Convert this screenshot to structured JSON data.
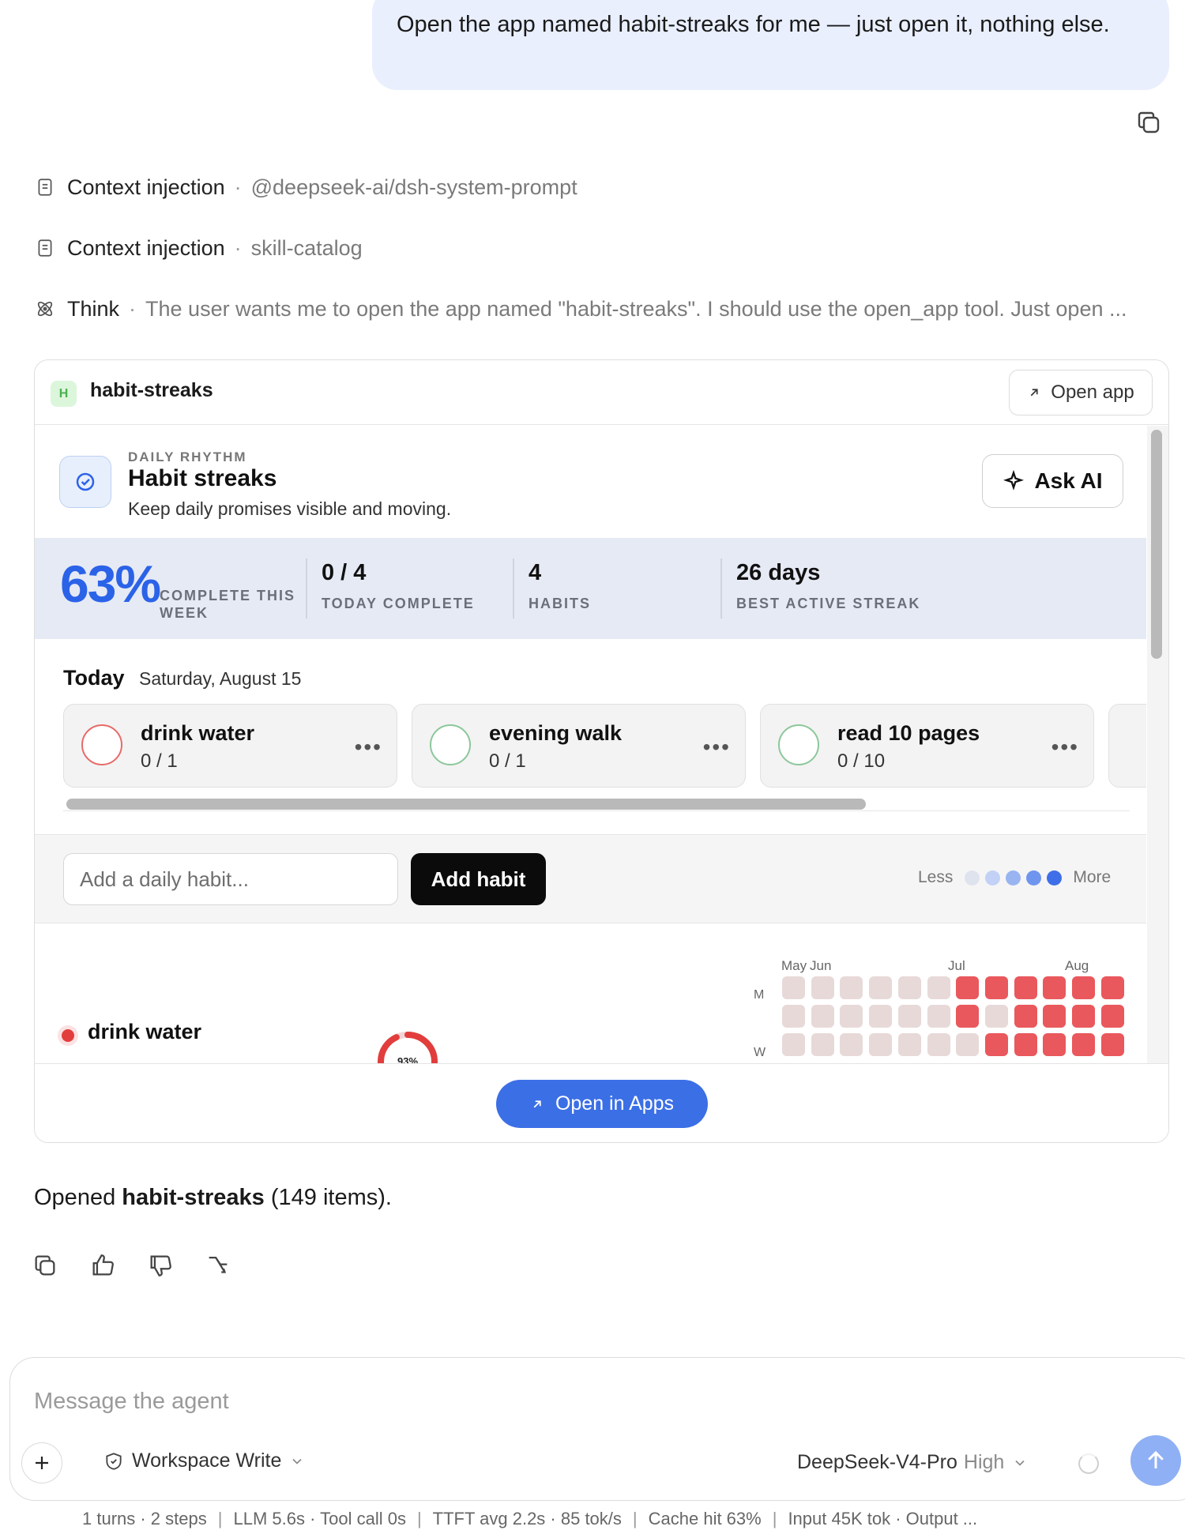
{
  "user_message": "Open the app named habit-streaks for me — just open it, nothing else.",
  "trace": [
    {
      "label": "Context injection",
      "detail": "@deepseek-ai/dsh-system-prompt"
    },
    {
      "label": "Context injection",
      "detail": "skill-catalog"
    },
    {
      "label": "Think",
      "detail": "The user wants me to open the app named \"habit-streaks\". I should use the open_app tool. Just open ..."
    }
  ],
  "app_card": {
    "badge": "H",
    "name": "habit-streaks",
    "open_app_label": "Open app",
    "open_in_apps_label": "Open in Apps"
  },
  "habit_app": {
    "eyebrow": "DAILY RHYTHM",
    "title": "Habit streaks",
    "subtitle": "Keep daily promises visible and moving.",
    "ask_ai_label": "Ask AI",
    "stats": {
      "week_pct": "63%",
      "week_label": "COMPLETE THIS WEEK",
      "items": [
        {
          "value": "0 / 4",
          "label": "TODAY COMPLETE"
        },
        {
          "value": "4",
          "label": "HABITS"
        },
        {
          "value": "26 days",
          "label": "BEST ACTIVE STREAK"
        }
      ]
    },
    "today_label": "Today",
    "today_date": "Saturday, August 15",
    "habits": [
      {
        "name": "drink water",
        "count": "0 / 1",
        "color": "#e86a6a"
      },
      {
        "name": "evening walk",
        "count": "0 / 1",
        "color": "#8cc79a"
      },
      {
        "name": "read 10 pages",
        "count": "0 / 10",
        "color": "#8cc79a"
      }
    ],
    "add_placeholder": "Add a daily habit...",
    "add_button": "Add habit",
    "legend": {
      "less": "Less",
      "more": "More",
      "colors": [
        "#dfe3ee",
        "#c2d1f5",
        "#98b4f1",
        "#6f95ee",
        "#3f6fe8"
      ]
    },
    "heatmap": {
      "months": [
        "May",
        "Jun",
        "Jul",
        "Aug"
      ],
      "days": [
        "M",
        "W"
      ],
      "habit_name": "drink water",
      "habit_color": "#e23d3d",
      "ring_pct": "93%",
      "ring_value": 0.93,
      "rows": [
        [
          0,
          0,
          0,
          0,
          0,
          0,
          1,
          1,
          1,
          1,
          1,
          1
        ],
        [
          0,
          0,
          0,
          0,
          0,
          0,
          1,
          0,
          1,
          1,
          1,
          1
        ],
        [
          0,
          0,
          0,
          0,
          0,
          0,
          0,
          1,
          1,
          1,
          1,
          1
        ]
      ],
      "colors": {
        "off": "#e8d9d9",
        "on": "#e9585c"
      }
    }
  },
  "result": {
    "prefix": "Opened ",
    "app": "habit-streaks",
    "suffix": " (149 items)."
  },
  "composer": {
    "placeholder": "Message the agent",
    "workspace_label": "Workspace Write",
    "model": "DeepSeek-V4-Pro",
    "level": "High"
  },
  "footer_stats": [
    "1 turns · 2 steps",
    "LLM 5.6s · Tool call 0s",
    "TTFT avg 2.2s · 85 tok/s",
    "Cache hit 63%",
    "Input 45K tok · Output ..."
  ]
}
